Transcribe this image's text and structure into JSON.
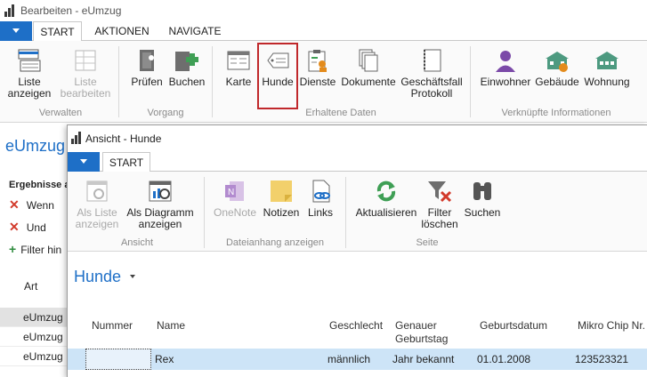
{
  "main": {
    "title": "Bearbeiten - eUmzug",
    "tabs": [
      "START",
      "AKTIONEN",
      "NAVIGATE"
    ],
    "ribbon": {
      "buttons": {
        "liste_anzeigen": "Liste anzeigen",
        "liste_bearbeiten": "Liste bearbeiten",
        "pruefen": "Prüfen",
        "buchen": "Buchen",
        "karte": "Karte",
        "hunde": "Hunde",
        "dienste": "Dienste",
        "dokumente": "Dokumente",
        "geschaeftsfall": "Geschäftsfall Protokoll",
        "einwohner": "Einwohner",
        "gebaeude": "Gebäude",
        "wohnung": "Wohnung"
      },
      "groups": {
        "verwalten": "Verwalten",
        "vorgang": "Vorgang",
        "erhaltene": "Erhaltene Daten",
        "verknuepfte": "Verknüpfte Informationen"
      }
    },
    "left": {
      "title": "eUmzug",
      "results_header": "Ergebnisse a",
      "wenn": "Wenn",
      "und": "Und",
      "filter": "Filter hin",
      "art": "Art",
      "rows": [
        "eUmzug",
        "eUmzug",
        "eUmzug"
      ]
    }
  },
  "overlay": {
    "title": "Ansicht - Hunde",
    "tab": "START",
    "ribbon": {
      "buttons": {
        "als_liste": "Als Liste anzeigen",
        "als_diagramm": "Als Diagramm anzeigen",
        "onenote": "OneNote",
        "notizen": "Notizen",
        "links": "Links",
        "aktualisieren": "Aktualisieren",
        "filter_loeschen": "Filter löschen",
        "suchen": "Suchen"
      },
      "groups": {
        "ansicht": "Ansicht",
        "dateianhang": "Dateianhang anzeigen",
        "seite": "Seite"
      }
    },
    "list_title": "Hunde",
    "columns": {
      "nummer": "Nummer",
      "name": "Name",
      "geschlecht": "Geschlecht",
      "genauer": "Genauer Geburtstag",
      "geburtsdatum": "Geburtsdatum",
      "chip": "Mikro Chip Nr."
    },
    "rows": [
      {
        "nummer": "",
        "name": "Rex",
        "geschlecht": "männlich",
        "genauer": "Jahr bekannt",
        "geburtsdatum": "01.01.2008",
        "chip": "123523321"
      }
    ]
  },
  "colors": {
    "accent": "#1e6fc7",
    "highlight": "#c0282b",
    "selected_row": "#cde4f7"
  }
}
